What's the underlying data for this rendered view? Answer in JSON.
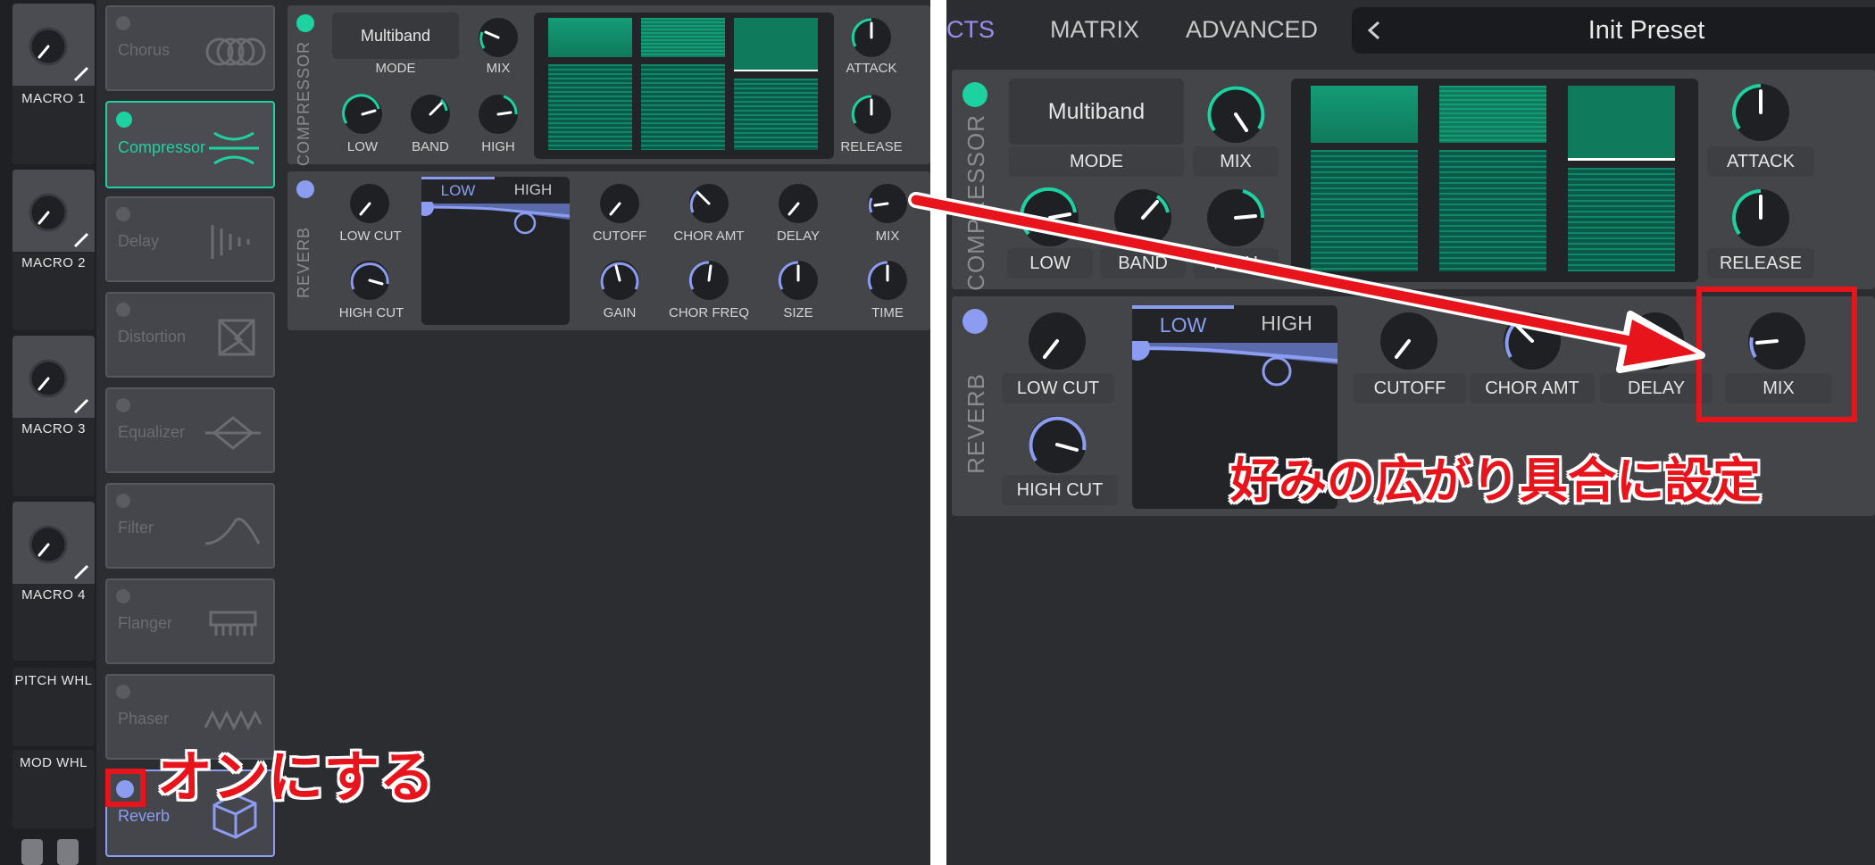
{
  "left": {
    "macros": [
      {
        "label": "MACRO 1"
      },
      {
        "label": "MACRO 2"
      },
      {
        "label": "MACRO 3"
      },
      {
        "label": "MACRO 4"
      }
    ],
    "wheels": [
      {
        "label": "PITCH WHL"
      },
      {
        "label": "MOD WHL"
      }
    ],
    "effects": [
      {
        "name": "Chorus",
        "icon": "chorus-icon"
      },
      {
        "name": "Compressor",
        "icon": "compressor-icon",
        "state": "on",
        "color": "#1ed1a0"
      },
      {
        "name": "Delay",
        "icon": "delay-icon"
      },
      {
        "name": "Distortion",
        "icon": "distortion-icon"
      },
      {
        "name": "Equalizer",
        "icon": "equalizer-icon"
      },
      {
        "name": "Filter",
        "icon": "filter-icon"
      },
      {
        "name": "Flanger",
        "icon": "flanger-icon"
      },
      {
        "name": "Phaser",
        "icon": "phaser-icon"
      },
      {
        "name": "Reverb",
        "icon": "reverb-icon",
        "color": "#8c9cf0"
      }
    ],
    "compressor": {
      "section_label": "COMPRESSOR",
      "mode_value": "Multiband",
      "mode_label": "MODE",
      "mix_label": "MIX",
      "low_label": "LOW",
      "band_label": "BAND",
      "high_label": "HIGH",
      "attack_label": "ATTACK",
      "release_label": "RELEASE"
    },
    "reverb": {
      "section_label": "REVERB",
      "low_cut": "LOW CUT",
      "high_cut": "HIGH CUT",
      "tab_low": "LOW",
      "tab_high": "HIGH",
      "cutoff": "CUTOFF",
      "chor_amt": "CHOR AMT",
      "delay": "DELAY",
      "mix": "MIX",
      "gain": "GAIN",
      "chor_freq": "CHOR FREQ",
      "size": "SIZE",
      "time": "TIME"
    },
    "callout": "オンにする"
  },
  "right": {
    "tabs": {
      "effects_partial": "CTS",
      "matrix": "MATRIX",
      "advanced": "ADVANCED"
    },
    "preset_name": "Init Preset",
    "compressor": {
      "section_label": "COMPRESSOR",
      "mode_value": "Multiband",
      "mode_label": "MODE",
      "mix_label": "MIX",
      "low_label": "LOW",
      "band_label": "BAND",
      "high_label_partial": "HIGH",
      "attack_label": "ATTACK",
      "release_label": "RELEASE"
    },
    "reverb": {
      "section_label": "REVERB",
      "low_cut": "LOW CUT",
      "high_cut": "HIGH CUT",
      "tab_low": "LOW",
      "tab_high": "HIGH",
      "cutoff": "CUTOFF",
      "chor_amt": "CHOR AMT",
      "delay": "DELAY",
      "mix": "MIX"
    },
    "callout": "好みの広がり具合に設定"
  },
  "colors": {
    "green": "#1ed1a0",
    "purple": "#8c9cf0",
    "red": "#e8141c",
    "panel": "#434549",
    "bg": "#2b2d31"
  }
}
